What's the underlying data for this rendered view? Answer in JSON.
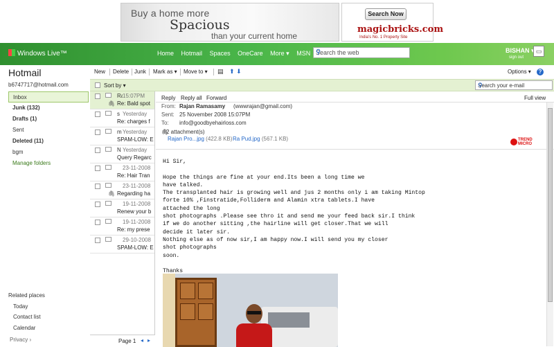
{
  "ad": {
    "left_line1": "Buy a home more",
    "left_line2": "Spacious",
    "left_line3": "than your current home",
    "right_button": "Search Now",
    "right_brand": "magicbricks.com",
    "right_tagline": "India's No. 1 Property Site"
  },
  "topbar": {
    "brand": "Windows Live™",
    "nav": [
      "Home",
      "Hotmail",
      "Spaces",
      "OneCare",
      "More ▾",
      "MSN"
    ],
    "search_placeholder": "Search the web",
    "user_name": "BISHAN ▾",
    "sign_out": "sign out"
  },
  "sidebar": {
    "title": "Hotmail",
    "email": "b6747717@hotmail.com",
    "folders": [
      {
        "label": "Inbox",
        "selected": true,
        "bold": false
      },
      {
        "label": "Junk (132)",
        "selected": false,
        "bold": true
      },
      {
        "label": "Drafts (1)",
        "selected": false,
        "bold": true
      },
      {
        "label": "Sent",
        "selected": false,
        "bold": false
      },
      {
        "label": "Deleted (11)",
        "selected": false,
        "bold": true
      },
      {
        "label": "bgm",
        "selected": false,
        "bold": false
      },
      {
        "label": "Manage folders",
        "selected": false,
        "bold": false
      }
    ],
    "related_title": "Related places",
    "related": [
      "Today",
      "Contact list",
      "Calendar"
    ],
    "privacy": "Privacy  ›"
  },
  "toolbar": {
    "new": "New",
    "delete": "Delete",
    "junk": "Junk",
    "mark_as": "Mark as ▾",
    "move_to": "Move to ▾",
    "options": "Options ▾",
    "help": "?"
  },
  "sortbar": {
    "sort_by": "Sort by ▾",
    "search_placeholder": "Search your e-mail"
  },
  "messages": [
    {
      "from": "Ra",
      "date": "15:07PM",
      "subject": "Re: Bald spot",
      "attachment": true,
      "selected": true
    },
    {
      "from": "s",
      "date": "Yesterday",
      "subject": "Re: charges f",
      "attachment": false,
      "selected": false
    },
    {
      "from": "m",
      "date": "Yesterday",
      "subject": "SPAM-LOW: E",
      "attachment": false,
      "selected": false
    },
    {
      "from": "N",
      "date": "Yesterday",
      "subject": "Query Regarc",
      "attachment": false,
      "selected": false
    },
    {
      "from": "",
      "date": "23-11-2008",
      "subject": "Re: Hair Tran",
      "attachment": false,
      "selected": false
    },
    {
      "from": "",
      "date": "23-11-2008",
      "subject": "Regarding ha",
      "attachment": true,
      "selected": false
    },
    {
      "from": "",
      "date": "19-11-2008",
      "subject": "Renew your b",
      "attachment": false,
      "selected": false
    },
    {
      "from": "",
      "date": "19-11-2008",
      "subject": "Re: my prese",
      "attachment": false,
      "selected": false
    },
    {
      "from": "",
      "date": "29-10-2008",
      "subject": "SPAM-LOW: E",
      "attachment": false,
      "selected": false
    }
  ],
  "pager": {
    "label": "Page 1",
    "prev": "◂",
    "next": "▸"
  },
  "reader": {
    "reply": "Reply",
    "reply_all": "Reply all",
    "forward": "Forward",
    "full_view": "Full view",
    "from_label": "From:",
    "from_name": "Rajan Ramasamy",
    "from_email": "(wwwrajan@gmail.com)",
    "sent_label": "Sent:",
    "sent": "25 November 2008 15:07PM",
    "to_label": "To:",
    "to": "info@goodbyehairloss.com",
    "attachments_label": "2 attachment(s)",
    "attachments": [
      {
        "name": "Rajan Pro...jpg",
        "size": "(422.8 KB)"
      },
      {
        "name": "Ra Pud.jpg",
        "size": "(567.1 KB)"
      }
    ],
    "trend": "TREND MICRO",
    "body": "Hi Sir,\n\nHope the things are fine at your end.Its been a long time we\nhave talked.\nThe transplanted hair is growing well and jus 2 months only i am taking Mintop\nforte 10% ,Finstratide,Folliderm and Alamin xtra tablets.I have\nattached the long\nshot photographs .Please see thro it and send me your feed back sir.I think\nif we do another sitting ,the hairline will get closer.That we will\ndecide it later sir.\nNothing else as of now sir,I am happy now.I will send you my closer\nshot photographs\nsoon.\n\nThanks\nRajan"
  }
}
